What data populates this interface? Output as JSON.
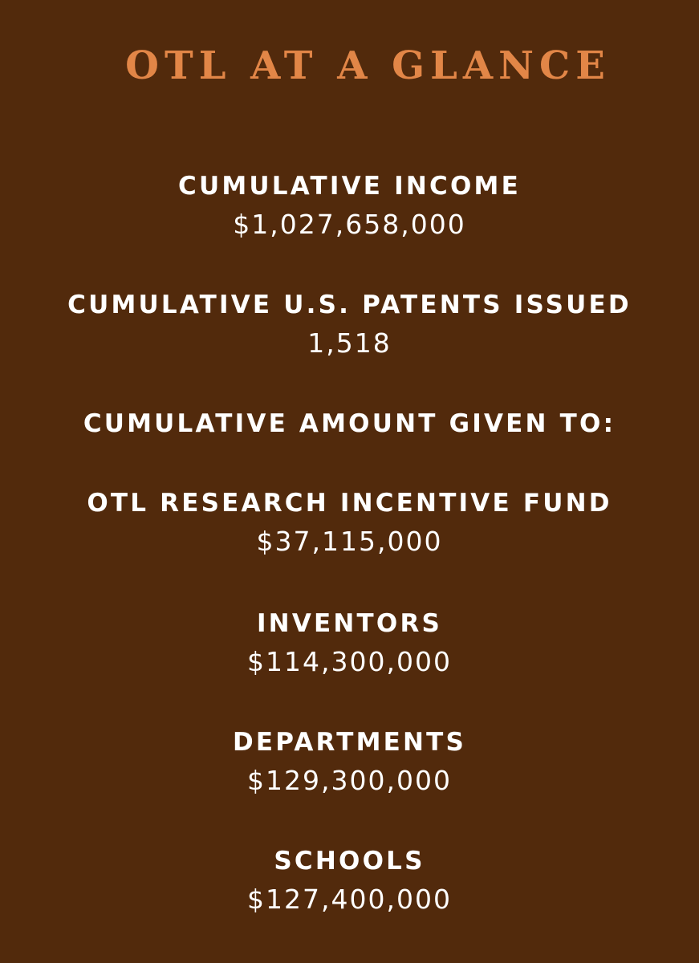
{
  "title": "OTL AT A GLANCE",
  "stats": [
    {
      "label": "CUMULATIVE INCOME",
      "value": "$1,027,658,000"
    },
    {
      "label": "CUMULATIVE U.S. PATENTS ISSUED",
      "value": "1,518"
    },
    {
      "label": "CUMULATIVE AMOUNT GIVEN TO:",
      "value": ""
    },
    {
      "label": "OTL RESEARCH INCENTIVE FUND",
      "value": "$37,115,000"
    },
    {
      "label": "INVENTORS",
      "value": "$114,300,000"
    },
    {
      "label": "DEPARTMENTS",
      "value": "$129,300,000"
    },
    {
      "label": "SCHOOLS",
      "value": "$127,400,000"
    }
  ],
  "colors": {
    "background": "#522a0c",
    "title": "#e28647",
    "text": "#ffffff"
  }
}
